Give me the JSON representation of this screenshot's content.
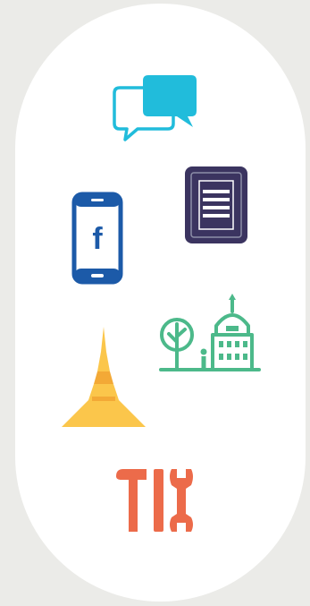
{
  "background_color": "#ebebe8",
  "panel_color": "#ffffff",
  "icons": [
    {
      "name": "chat-bubbles-icon",
      "colors": [
        "#21bcdb"
      ]
    },
    {
      "name": "document-icon",
      "colors": [
        "#3b3460",
        "#8d8fa8"
      ]
    },
    {
      "name": "facebook-phone-icon",
      "label": "f",
      "colors": [
        "#1c5aa8"
      ]
    },
    {
      "name": "tree-and-capitol-icon",
      "colors": [
        "#4cb98a"
      ]
    },
    {
      "name": "pagoda-icon",
      "colors": [
        "#fbc64b",
        "#f3a936"
      ]
    },
    {
      "name": "hammer-and-wrench-icon",
      "colors": [
        "#ec6b4a"
      ]
    }
  ]
}
